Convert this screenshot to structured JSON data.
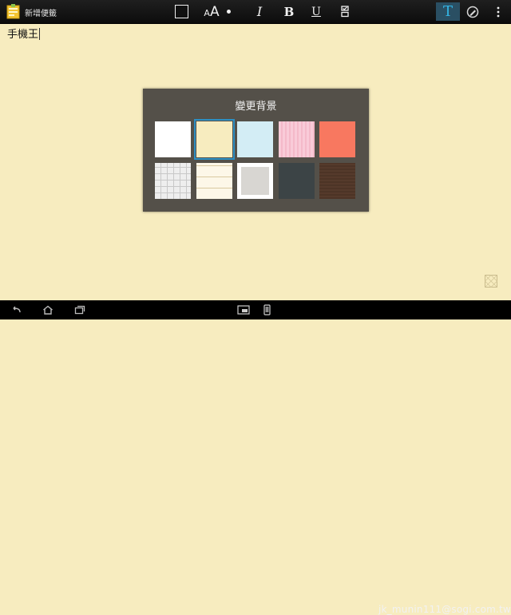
{
  "header": {
    "title": "新增便籤",
    "icons": {
      "app": "sticky-note-icon",
      "color": "color-swatch-icon",
      "font_size": "font-size-icon",
      "dot": "brush-size-dot-icon",
      "italic": "italic-icon",
      "bold": "bold-icon",
      "underline": "underline-icon",
      "checklist": "checklist-icon",
      "text_mode": "text-mode-icon",
      "draw_mode": "draw-mode-icon",
      "overflow": "overflow-menu-icon"
    },
    "glyphs": {
      "font_small": "A",
      "font_large": "A",
      "italic": "I",
      "bold": "B",
      "underline": "U",
      "text_mode": "T"
    },
    "active_mode": "text"
  },
  "note": {
    "text": "手機王"
  },
  "dialog": {
    "title": "變更背景",
    "selected_index": 1,
    "backgrounds": [
      {
        "name": "white",
        "color": "#ffffff"
      },
      {
        "name": "cream",
        "color": "#f7ecbf"
      },
      {
        "name": "light-blue",
        "color": "#d3edf5"
      },
      {
        "name": "pink-striped",
        "color": "#f9cbd8"
      },
      {
        "name": "coral",
        "color": "#f87860"
      },
      {
        "name": "grid-paper",
        "color": "#eeeeee"
      },
      {
        "name": "lined-paper",
        "color": "#fdf7e8"
      },
      {
        "name": "gray-framed",
        "color": "#d8d6d2"
      },
      {
        "name": "dark-slate",
        "color": "#3c4446"
      },
      {
        "name": "dark-brown",
        "color": "#4d3426"
      }
    ]
  },
  "colors": {
    "accent": "#33b5e5",
    "note_background": "#f7ecbf",
    "dialog": "#545049"
  },
  "navbar": {
    "icons": [
      "back-icon",
      "home-icon",
      "recent-apps-icon",
      "screenshot-icon",
      "phone-icon"
    ]
  },
  "watermark": {
    "text": "jk_munin111@sogi.com.tw"
  }
}
